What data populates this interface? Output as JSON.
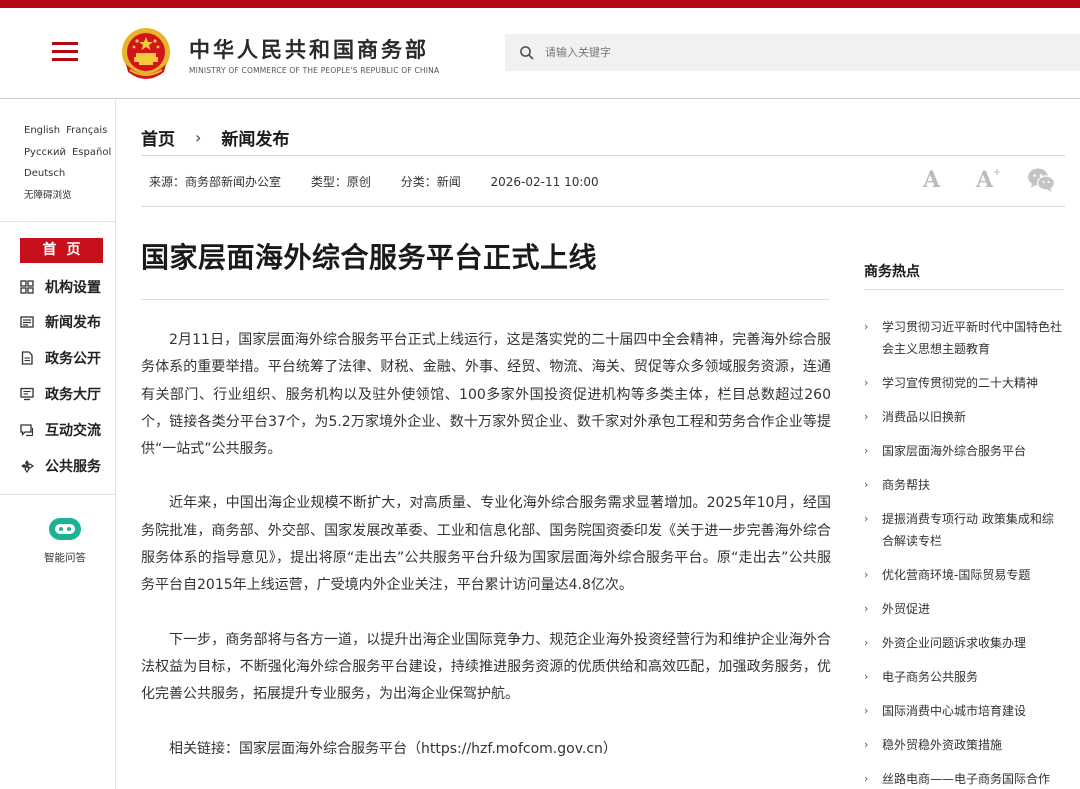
{
  "header": {
    "title_cn": "中华人民共和国商务部",
    "title_en": "MINISTRY OF COMMERCE OF THE PEOPLE'S REPUBLIC OF CHINA",
    "search_placeholder": "请输入关键字"
  },
  "colors": {
    "brand_red": "#b40a16",
    "nav_active": "#c8101c"
  },
  "leftnav": {
    "languages": [
      "English",
      "Français",
      "Русский",
      "Español",
      "Deutsch"
    ],
    "accessibility": "无障碍浏览",
    "home": "首页",
    "items": [
      {
        "label": "机构设置",
        "icon": "org-chart-icon"
      },
      {
        "label": "新闻发布",
        "icon": "newspaper-icon"
      },
      {
        "label": "政务公开",
        "icon": "document-icon"
      },
      {
        "label": "政务大厅",
        "icon": "monitor-icon"
      },
      {
        "label": "互动交流",
        "icon": "chat-icon"
      },
      {
        "label": "公共服务",
        "icon": "service-icon"
      }
    ],
    "bot_label": "智能问答"
  },
  "breadcrumb": {
    "home": "首页",
    "sep": "›",
    "current": "新闻发布"
  },
  "meta": {
    "source": "来源：商务部新闻办公室",
    "type": "类型：原创",
    "category": "分类：新闻",
    "datetime": "2026-02-11 10:00"
  },
  "toolbar": {
    "font_small": "A",
    "font_large": "A",
    "font_large_sup": "+"
  },
  "article": {
    "title": "国家层面海外综合服务平台正式上线",
    "paragraphs": [
      "2月11日，国家层面海外综合服务平台正式上线运行，这是落实党的二十届四中全会精神，完善海外综合服务体系的重要举措。平台统筹了法律、财税、金融、外事、经贸、物流、海关、贸促等众多领域服务资源，连通有关部门、行业组织、服务机构以及驻外使领馆、100多家外国投资促进机构等多类主体，栏目总数超过260个，链接各类分平台37个，为5.2万家境外企业、数十万家外贸企业、数千家对外承包工程和劳务合作企业等提供“一站式”公共服务。",
      "近年来，中国出海企业规模不断扩大，对高质量、专业化海外综合服务需求显著增加。2025年10月，经国务院批准，商务部、外交部、国家发展改革委、工业和信息化部、国务院国资委印发《关于进一步完善海外综合服务体系的指导意见》，提出将原“走出去”公共服务平台升级为国家层面海外综合服务平台。原“走出去”公共服务平台自2015年上线运营，广受境内外企业关注，平台累计访问量达4.8亿次。",
      "下一步，商务部将与各方一道，以提升出海企业国际竞争力、规范企业海外投资经营行为和维护企业海外合法权益为目标，不断强化海外综合服务平台建设，持续推进服务资源的优质供给和高效匹配，加强政务服务，优化完善公共服务，拓展提升专业服务，为出海企业保驾护航。",
      "相关链接：国家层面海外综合服务平台（https://hzf.mofcom.gov.cn）"
    ]
  },
  "sidebar": {
    "title": "商务热点",
    "items": [
      "学习贯彻习近平新时代中国特色社会主义思想主题教育",
      "学习宣传贯彻党的二十大精神",
      "消费品以旧换新",
      "国家层面海外综合服务平台",
      "商务帮扶",
      "提振消费专项行动 政策集成和综合解读专栏",
      "优化营商环境-国际贸易专题",
      "外贸促进",
      "外资企业问题诉求收集办理",
      "电子商务公共服务",
      "国际消费中心城市培育建设",
      "稳外贸稳外资政策措施",
      "丝路电商——电子商务国际合作"
    ]
  }
}
